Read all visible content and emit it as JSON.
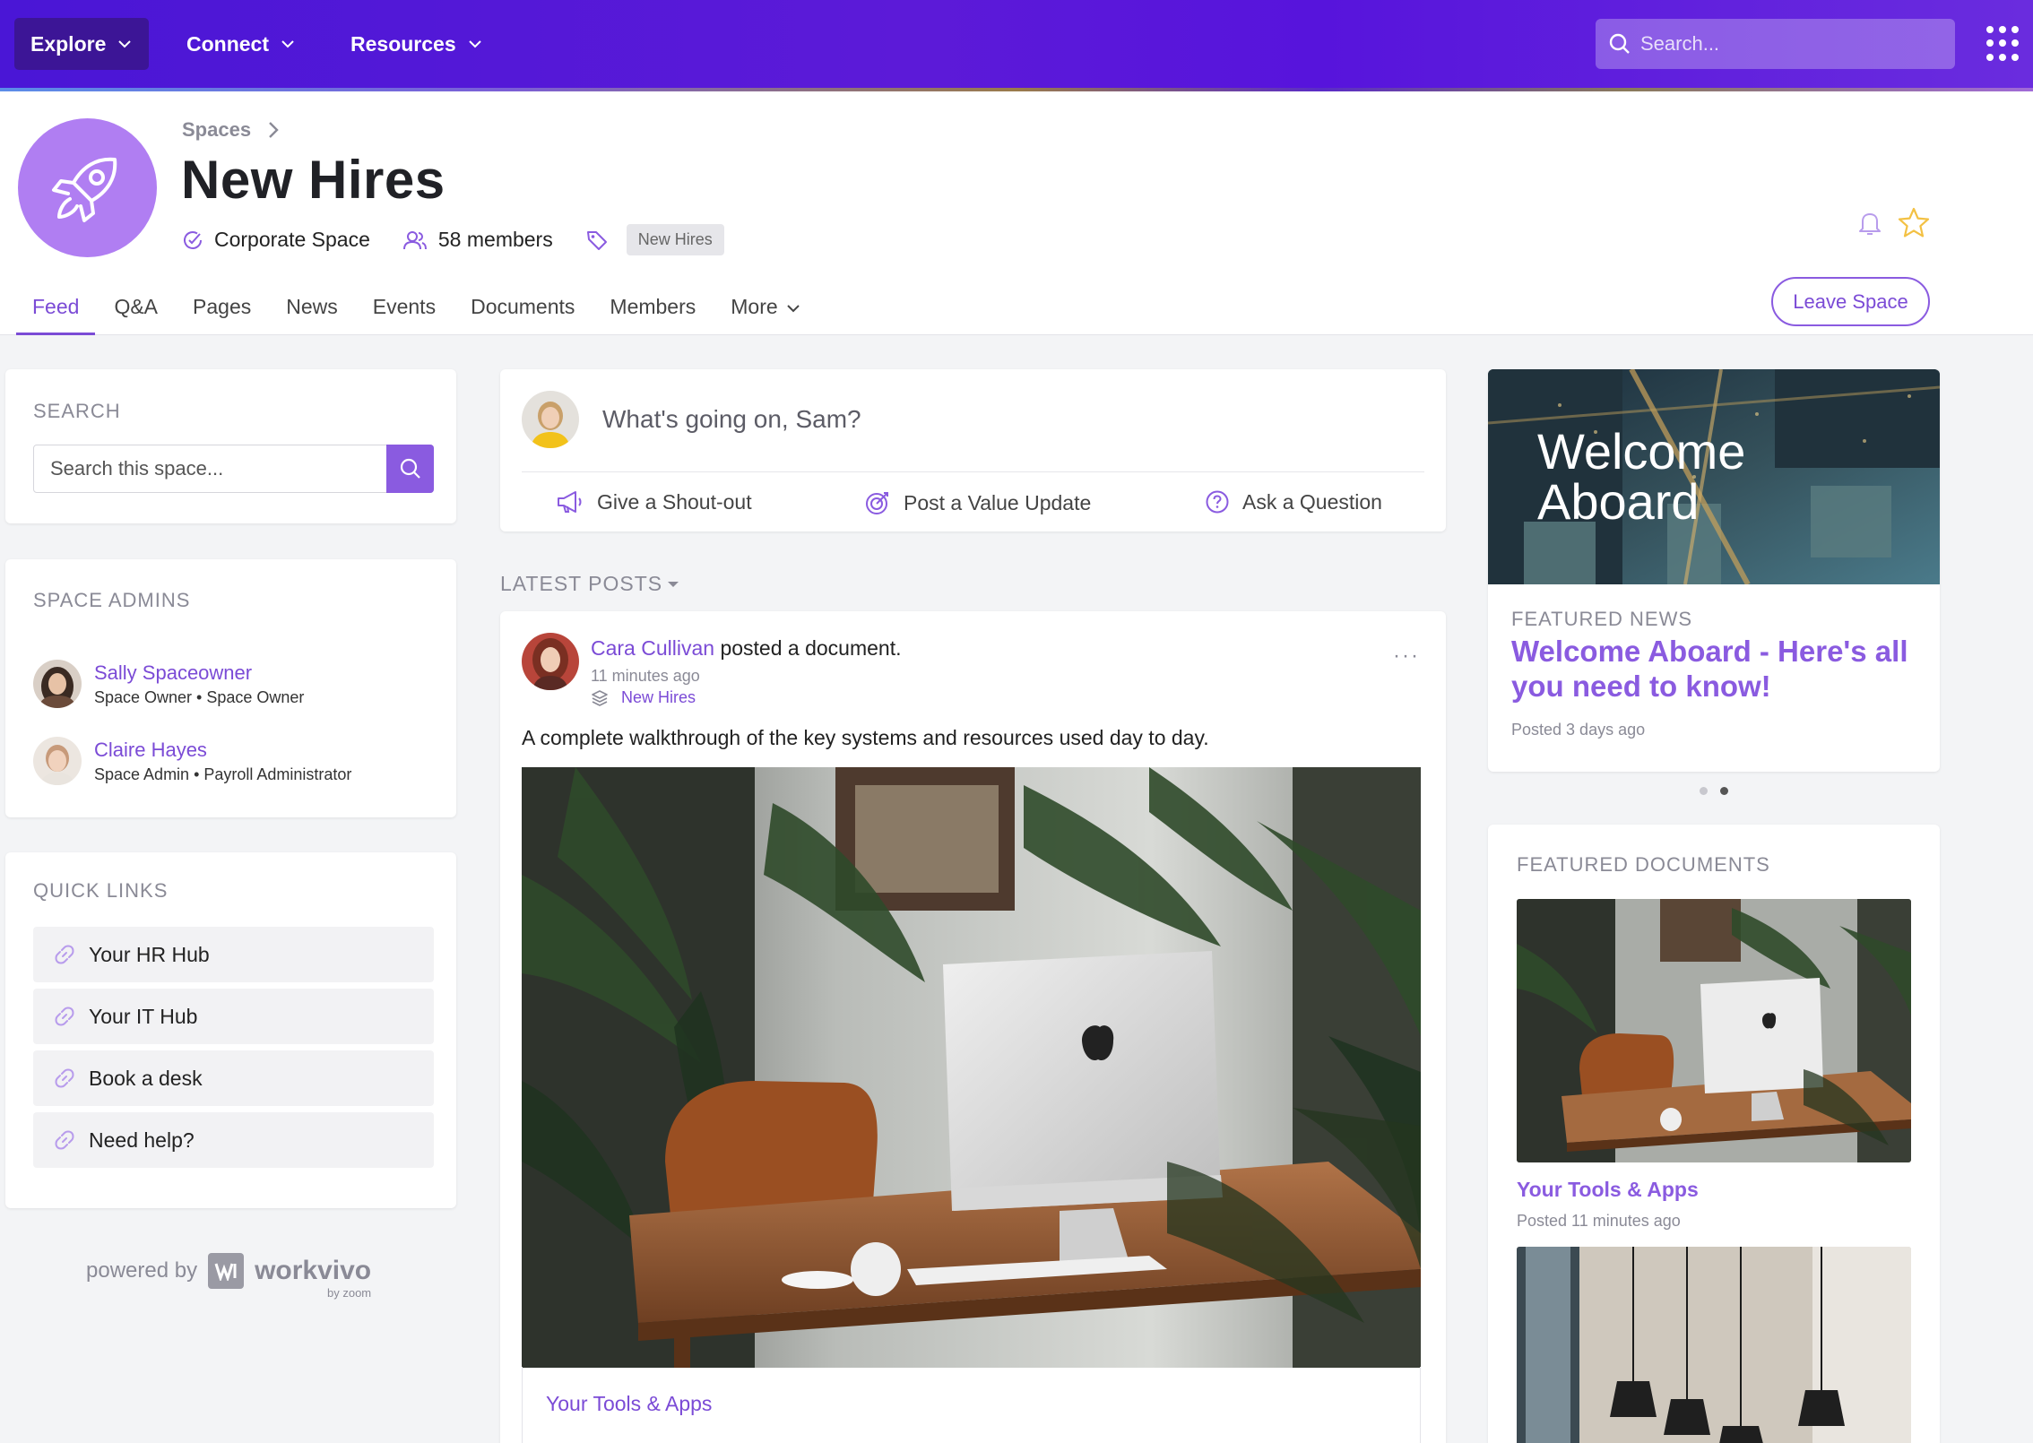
{
  "topnav": {
    "items": [
      {
        "label": "Explore"
      },
      {
        "label": "Connect"
      },
      {
        "label": "Resources"
      }
    ],
    "search_placeholder": "Search..."
  },
  "header": {
    "breadcrumb": "Spaces",
    "title": "New Hires",
    "space_type": "Corporate Space",
    "members": "58 members",
    "tag": "New Hires",
    "leave_label": "Leave Space"
  },
  "tabs": [
    "Feed",
    "Q&A",
    "Pages",
    "News",
    "Events",
    "Documents",
    "Members",
    "More"
  ],
  "sidebar": {
    "search_title": "SEARCH",
    "search_placeholder": "Search this space...",
    "admins_title": "SPACE ADMINS",
    "admins": [
      {
        "name": "Sally Spaceowner",
        "role": "Space Owner • Space Owner"
      },
      {
        "name": "Claire Hayes",
        "role": "Space Admin • Payroll Administrator"
      }
    ],
    "links_title": "QUICK LINKS",
    "links": [
      "Your HR Hub",
      "Your IT Hub",
      "Book a desk",
      "Need help?"
    ],
    "powered_by": "powered by",
    "brand": "workvivo",
    "brand_sub": "by zoom"
  },
  "composer": {
    "prompt": "What's going on, Sam?",
    "actions": [
      "Give a Shout-out",
      "Post a Value Update",
      "Ask a Question"
    ]
  },
  "feed": {
    "section_title": "LATEST POSTS",
    "post": {
      "author": "Cara Cullivan",
      "action": "posted a document.",
      "time": "11 minutes ago",
      "space": "New Hires",
      "body": "A complete walkthrough of the key systems and resources used day to day.",
      "attachment": "Your Tools & Apps"
    }
  },
  "featured_news": {
    "image_text_1": "Welcome",
    "image_text_2": "Aboard",
    "title": "FEATURED NEWS",
    "headline": "Welcome Aboard - Here's all you need to know!",
    "date": "Posted 3 days ago"
  },
  "featured_docs": {
    "title": "FEATURED DOCUMENTS",
    "doc_title": "Your Tools & Apps",
    "doc_date": "Posted 11 minutes ago"
  },
  "colors": {
    "brand_purple": "#7b4bd6",
    "topbar": "#5514d8",
    "space_avatar": "#b07ef2"
  }
}
